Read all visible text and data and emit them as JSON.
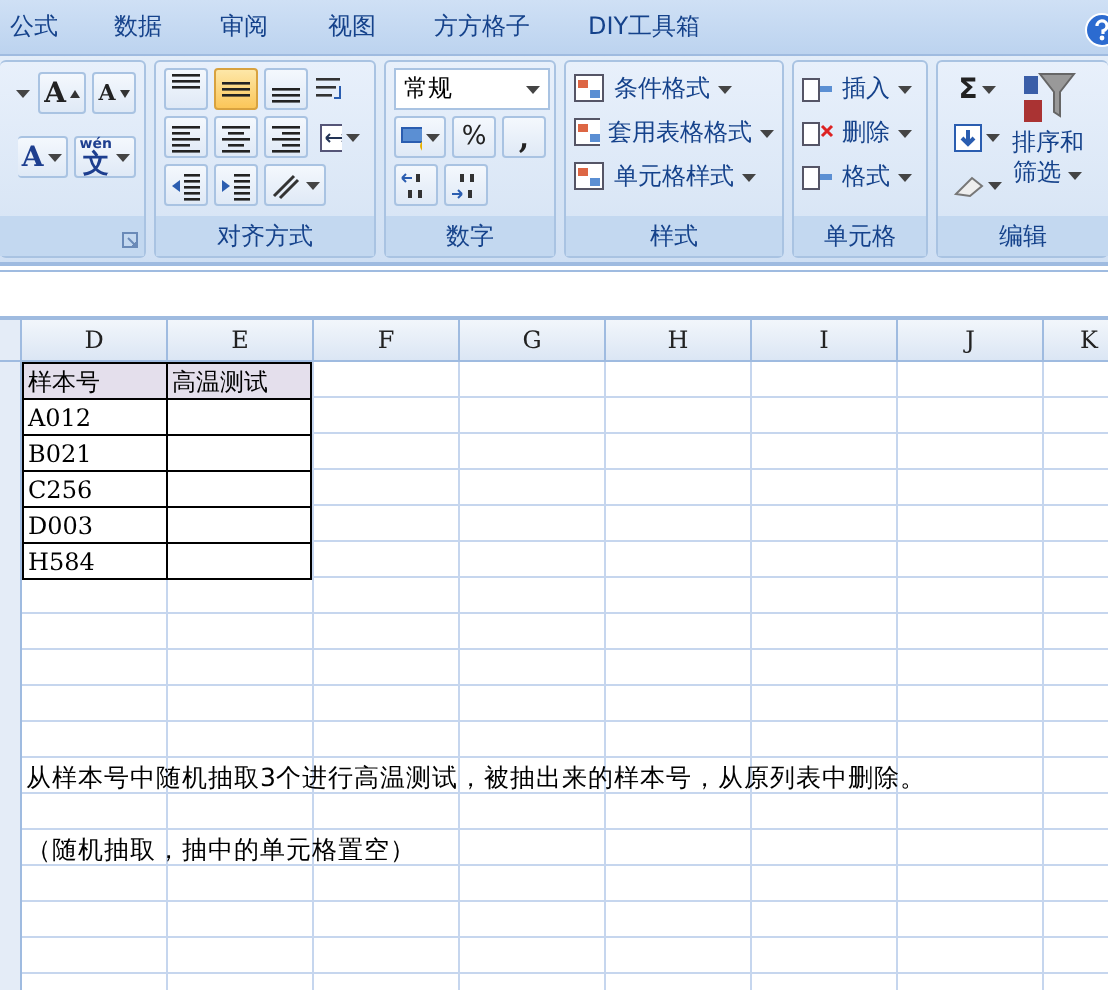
{
  "menu_tabs": [
    {
      "label": "公式",
      "selected": false
    },
    {
      "label": "数据",
      "selected": false
    },
    {
      "label": "审阅",
      "selected": false
    },
    {
      "label": "视图",
      "selected": false
    },
    {
      "label": "方方格子",
      "selected": false
    },
    {
      "label": "DIY工具箱",
      "selected": false
    }
  ],
  "ribbon": {
    "font": {
      "grow_label": "A",
      "shrink_label": "A",
      "color_label": "A",
      "phonetic_label": "文",
      "phonetic_ruby": "wén"
    },
    "alignment": {
      "title": "对齐方式",
      "top_selected": false,
      "middle_selected": true,
      "bottom_selected": false
    },
    "number": {
      "title": "数字",
      "format": "常规",
      "percent": "%",
      "comma": ","
    },
    "styles": {
      "title": "样式",
      "items": [
        "条件格式",
        "套用表格格式",
        "单元格样式"
      ]
    },
    "cells": {
      "title": "单元格",
      "items": [
        "插入",
        "删除",
        "格式"
      ]
    },
    "editing": {
      "title": "编辑",
      "sum": "Σ",
      "sort_line1": "排序和",
      "sort_line2": "筛选"
    }
  },
  "sheet": {
    "columns": [
      "D",
      "E",
      "F",
      "G",
      "H",
      "I",
      "J",
      "K"
    ],
    "table": {
      "header": [
        "样本号",
        "高温测试"
      ],
      "rows": [
        [
          "A012",
          ""
        ],
        [
          "B021",
          ""
        ],
        [
          "C256",
          ""
        ],
        [
          "D003",
          ""
        ],
        [
          "H584",
          ""
        ]
      ]
    },
    "notes": [
      "从样本号中随机抽取3个进行高温测试，被抽出来的样本号，从原列表中删除。",
      "（随机抽取，抽中的单元格置空）"
    ]
  }
}
